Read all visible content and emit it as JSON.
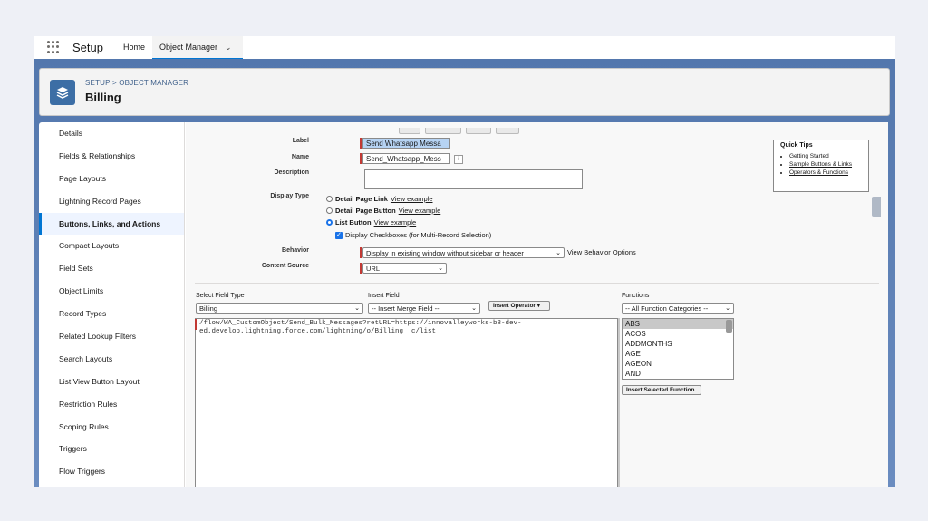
{
  "topbar": {
    "app_name": "Setup",
    "home_label": "Home",
    "tab_label": "Object Manager"
  },
  "header": {
    "breadcrumb": "SETUP > OBJECT MANAGER",
    "title": "Billing"
  },
  "sidebar": {
    "items": [
      {
        "label": "Details",
        "active": false
      },
      {
        "label": "Fields & Relationships",
        "active": false
      },
      {
        "label": "Page Layouts",
        "active": false
      },
      {
        "label": "Lightning Record Pages",
        "active": false
      },
      {
        "label": "Buttons, Links, and Actions",
        "active": true
      },
      {
        "label": "Compact Layouts",
        "active": false
      },
      {
        "label": "Field Sets",
        "active": false
      },
      {
        "label": "Object Limits",
        "active": false
      },
      {
        "label": "Record Types",
        "active": false
      },
      {
        "label": "Related Lookup Filters",
        "active": false
      },
      {
        "label": "Search Layouts",
        "active": false
      },
      {
        "label": "List View Button Layout",
        "active": false
      },
      {
        "label": "Restriction Rules",
        "active": false
      },
      {
        "label": "Scoping Rules",
        "active": false
      },
      {
        "label": "Triggers",
        "active": false
      },
      {
        "label": "Flow Triggers",
        "active": false
      }
    ]
  },
  "form": {
    "label_label": "Label",
    "label_value": "Send Whatsapp Messa",
    "name_label": "Name",
    "name_value": "Send_Whatsapp_Mess",
    "info_glyph": "i",
    "description_label": "Description",
    "description_value": "",
    "display_type_label": "Display Type",
    "display_types": [
      {
        "label": "Detail Page Link",
        "link": "View example",
        "selected": false
      },
      {
        "label": "Detail Page Button",
        "link": "View example",
        "selected": false
      },
      {
        "label": "List Button",
        "link": "View example",
        "selected": true
      }
    ],
    "display_checkboxes_label": "Display Checkboxes (for Multi-Record Selection)",
    "display_checkboxes_checked": true,
    "behavior_label": "Behavior",
    "behavior_value": "Display in existing window without sidebar or header",
    "behavior_link": "View Behavior Options",
    "content_source_label": "Content Source",
    "content_source_value": "URL"
  },
  "quick_tips": {
    "title": "Quick Tips",
    "links": [
      "Getting Started",
      "Sample Buttons & Links",
      "Operators & Functions"
    ]
  },
  "formula": {
    "select_field_type_label": "Select Field Type",
    "select_field_type_value": "Billing",
    "insert_field_label": "Insert Field",
    "insert_field_value": "-- Insert Merge Field --",
    "insert_operator_label": "Insert Operator",
    "functions_label": "Functions",
    "functions_category_value": "-- All Function Categories --",
    "functions": [
      "ABS",
      "ACOS",
      "ADDMONTHS",
      "AGE",
      "AGEON",
      "AND"
    ],
    "selected_function": "ABS",
    "insert_selected_function_label": "Insert Selected Function",
    "url_line1": "/flow/WA_CustomObject/Send_Bulk_Messages?retURL=https://innovalleyworks-b8-dev-",
    "url_line2": "ed.develop.lightning.force.com/lightning/o/Billing__c/list"
  },
  "colors": {
    "accent": "#0176d3",
    "band": "#5377ad",
    "required": "#c23934"
  }
}
